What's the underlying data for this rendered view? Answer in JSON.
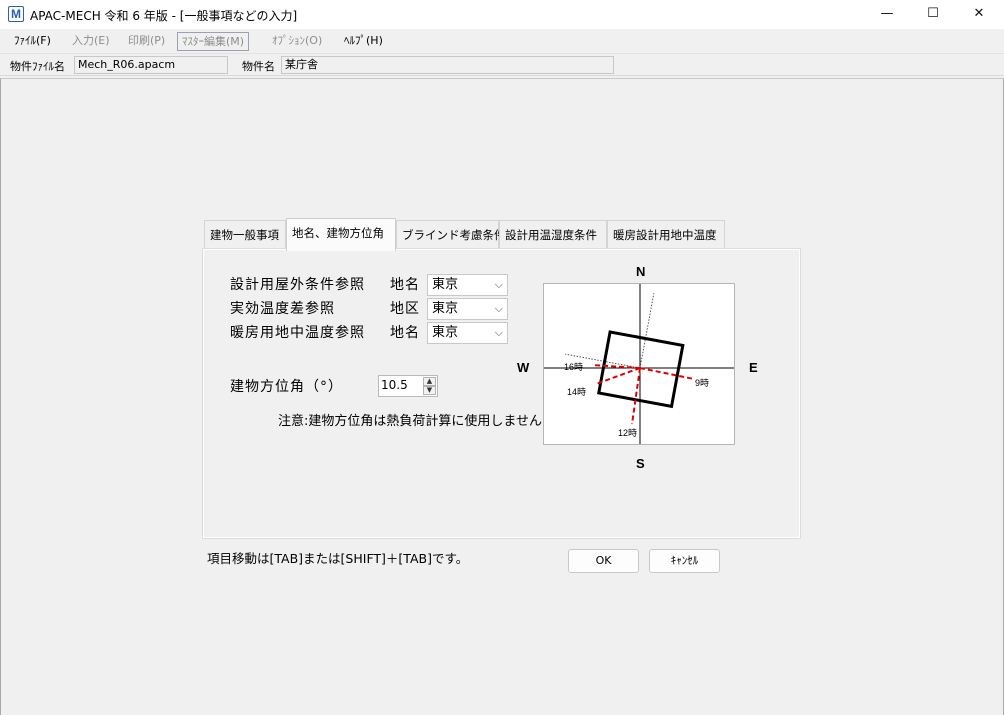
{
  "window": {
    "title": "APAC-MECH 令和 6 年版 - [一般事項などの入力]",
    "app_icon_glyph": "M",
    "controls": {
      "minimize": "—",
      "maximize": "☐",
      "close": "✕"
    }
  },
  "menu": [
    {
      "label": "ﾌｧｲﾙ(F)",
      "enabled": true
    },
    {
      "label": "入力(E)",
      "enabled": false
    },
    {
      "label": "印刷(P)",
      "enabled": false
    },
    {
      "label": "ﾏｽﾀｰ編集(M)",
      "enabled": false
    },
    {
      "label": "ｵﾌﾟｼｮﾝ(O)",
      "enabled": false
    },
    {
      "label": "ﾍﾙﾌﾟ(H)",
      "enabled": true
    }
  ],
  "infobar": {
    "file_label": "物件ﾌｧｲﾙ名",
    "file_value": "Mech_R06.apacm",
    "name_label": "物件名",
    "name_value": "某庁舎"
  },
  "tabs": [
    {
      "label": "建物一般事項",
      "active": false
    },
    {
      "label": "地名、建物方位角",
      "active": true
    },
    {
      "label": "ブラインド考慮条件",
      "active": false
    },
    {
      "label": "設計用温湿度条件",
      "active": false
    },
    {
      "label": "暖房設計用地中温度",
      "active": false
    }
  ],
  "form": {
    "rows": [
      {
        "label": "設計用屋外条件参照",
        "sublabel": "地名",
        "value": "東京"
      },
      {
        "label": "実効温度差参照",
        "sublabel": "地区",
        "value": "東京"
      },
      {
        "label": "暖房用地中温度参照",
        "sublabel": "地名",
        "value": "東京"
      }
    ],
    "azimuth_label": "建物方位角（°）",
    "azimuth_value": "10.5",
    "note": "注意:建物方位角は熱負荷計算に使用しません"
  },
  "compass": {
    "north": "N",
    "south": "S",
    "east": "E",
    "west": "W",
    "azimuth_deg": 10.5,
    "hour_labels": [
      "16時",
      "14時",
      "12時",
      "9時"
    ],
    "sun_ray_color": "#e00000",
    "building_color": "#000000"
  },
  "footer": {
    "hint": "項目移動は[TAB]または[SHIFT]＋[TAB]です。",
    "ok": "OK",
    "cancel": "ｷｬﾝｾﾙ"
  }
}
